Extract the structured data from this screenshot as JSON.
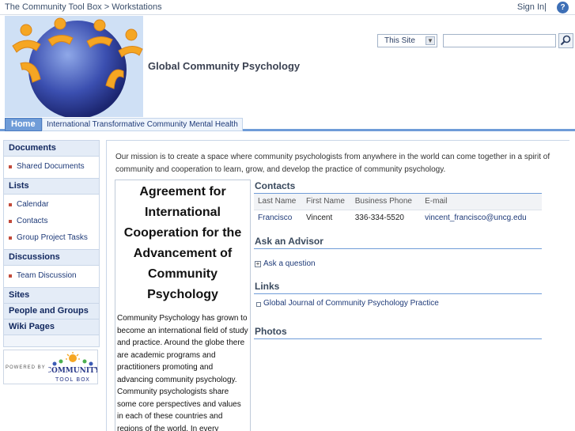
{
  "topbar": {
    "breadcrumb": "The Community Tool Box > Workstations",
    "signin": "Sign In|",
    "help_icon": "help-icon"
  },
  "header": {
    "site_title": "Global Community Psychology",
    "scope_label": "This Site",
    "search_value": ""
  },
  "tabs": {
    "home": "Home",
    "item": "International Transformative Community Mental Health"
  },
  "nav": {
    "documents": "Documents",
    "documents_items": [
      "Shared Documents"
    ],
    "lists": "Lists",
    "lists_items": [
      "Calendar",
      "Contacts",
      "Group Project Tasks"
    ],
    "discussions": "Discussions",
    "discussions_items": [
      "Team Discussion"
    ],
    "sites": "Sites",
    "people": "People and Groups",
    "wiki": "Wiki Pages"
  },
  "powered": {
    "label": "POWERED BY",
    "logo_top": "COMMUNITY",
    "logo_bottom": "TOOL BOX"
  },
  "main": {
    "mission": "Our mission is to create a space where community psychologists from anywhere in the world can come together in a spirit of community and cooperation to learn, grow, and develop the practice of community psychology.",
    "article_title": "Agreement for International Cooperation for the Advancement of Community Psychology",
    "article_body": "Community Psychology has grown to become an international field of study and practice. Around the globe there are academic programs and practitioners promoting and advancing community psychology. Community psychologists share some core perspectives and values in each of these countries and regions of the world. In every inhabited continent of"
  },
  "contacts": {
    "title": "Contacts",
    "columns": [
      "Last Name",
      "First Name",
      "Business Phone",
      "E-mail"
    ],
    "rows": [
      [
        "Francisco",
        "Vincent",
        "336-334-5520",
        "vincent_francisco@uncg.edu"
      ]
    ]
  },
  "advisor": {
    "title": "Ask an Advisor",
    "item": "Ask a question"
  },
  "links": {
    "title": "Links",
    "item": "Global Journal of Community Psychology Practice"
  },
  "photos": {
    "title": "Photos"
  },
  "colors": {
    "tab_blue": "#6f9cd8",
    "nav_text": "#11275e",
    "link": "#1e3a78"
  }
}
